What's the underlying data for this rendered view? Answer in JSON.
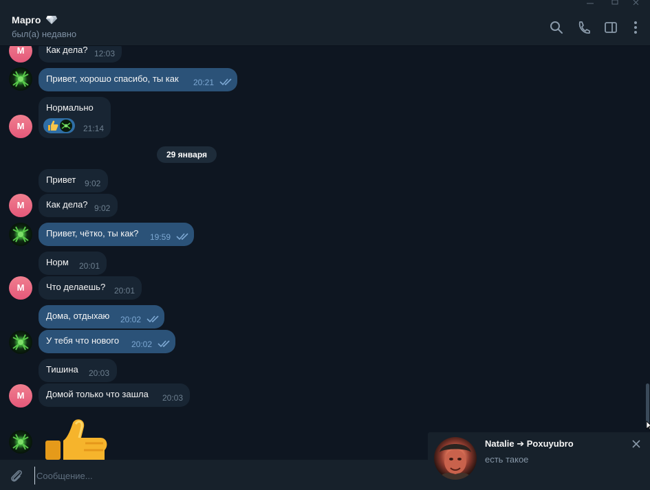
{
  "header": {
    "title": "Марго",
    "title_emoji_icon": "gem-icon",
    "status": "был(а) недавно",
    "actions": [
      "search-icon",
      "phone-icon",
      "sidebar-toggle-icon",
      "more-vertical-icon"
    ]
  },
  "colors": {
    "background": "#0e1621",
    "header": "#17212b",
    "incoming_bubble": "#182533",
    "outgoing_bubble": "#2b5278",
    "avatar_m": "#e4587a",
    "accent": "#5eb5f7"
  },
  "messages": [
    {
      "text": "Как дела?",
      "time": "12:03",
      "direction": "in"
    },
    {
      "text": "Привет, хорошо спасибо, ты как",
      "time": "20:21",
      "direction": "out"
    },
    {
      "text": "Нормально",
      "time": "21:14",
      "direction": "in",
      "reactions": [
        "thumbs-up-icon",
        "avatar-icon"
      ]
    },
    {
      "text": "Привет",
      "time": "9:02",
      "direction": "in"
    },
    {
      "text": "Как дела?",
      "time": "9:02",
      "direction": "in"
    },
    {
      "text": "Привет, чётко, ты как?",
      "time": "19:59",
      "direction": "out"
    },
    {
      "text": "Норм",
      "time": "20:01",
      "direction": "in"
    },
    {
      "text": "Что делаешь?",
      "time": "20:01",
      "direction": "in"
    },
    {
      "text": "Дома, отдыхаю",
      "time": "20:02",
      "direction": "out"
    },
    {
      "text": "У тебя что нового",
      "time": "20:02",
      "direction": "out"
    },
    {
      "text": "Тишина",
      "time": "20:03",
      "direction": "in"
    },
    {
      "text": "Домой только что зашла",
      "time": "20:03",
      "direction": "in"
    },
    {
      "sticker": "thumbs-up-sticker",
      "direction": "out"
    }
  ],
  "avatar_letter": "М",
  "date_divider": "29 января",
  "notification": {
    "title": "Natalie ➔ Poxuyubro",
    "text": "есть такое",
    "close_icon": "close-icon"
  },
  "composer": {
    "placeholder": "Сообщение...",
    "value": "",
    "attach_icon": "paperclip-icon"
  }
}
